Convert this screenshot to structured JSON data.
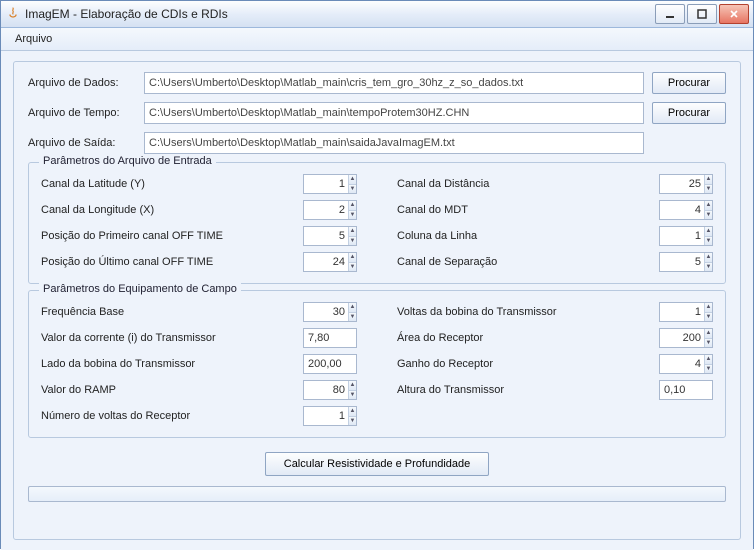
{
  "window": {
    "title": "ImagEM - Elaboração de CDIs e RDIs"
  },
  "menu": {
    "arquivo": "Arquivo"
  },
  "files": {
    "data_label": "Arquivo de Dados:",
    "data_value": "C:\\Users\\Umberto\\Desktop\\Matlab_main\\cris_tem_gro_30hz_z_so_dados.txt",
    "time_label": "Arquivo de Tempo:",
    "time_value": "C:\\Users\\Umberto\\Desktop\\Matlab_main\\tempoProtem30HZ.CHN",
    "out_label": "Arquivo de Saída:",
    "out_value": "C:\\Users\\Umberto\\Desktop\\Matlab_main\\saidaJavaImagEM.txt",
    "browse": "Procurar"
  },
  "group1": {
    "title": "Parâmetros do Arquivo de Entrada",
    "lat_label": "Canal da Latitude (Y)",
    "lat": "1",
    "lon_label": "Canal da Longitude (X)",
    "lon": "2",
    "first_off_label": "Posição do Primeiro canal OFF TIME",
    "first_off": "5",
    "last_off_label": "Posição do Último canal OFF TIME",
    "last_off": "24",
    "dist_label": "Canal da Distância",
    "dist": "25",
    "mdt_label": "Canal do MDT",
    "mdt": "4",
    "linha_label": "Coluna da Linha",
    "linha": "1",
    "sep_label": "Canal de Separação",
    "sep": "5"
  },
  "group2": {
    "title": "Parâmetros do Equipamento de Campo",
    "freq_label": "Frequência Base",
    "freq": "30",
    "corrente_label": "Valor da corrente (i) do Transmissor",
    "corrente": "7,80",
    "lado_label": "Lado da bobina do Transmissor",
    "lado": "200,00",
    "ramp_label": "Valor do RAMP",
    "ramp": "80",
    "voltas_rx_label": "Número de voltas do Receptor",
    "voltas_rx": "1",
    "voltas_tx_label": "Voltas da bobina do Transmissor",
    "voltas_tx": "1",
    "area_rx_label": "Área do Receptor",
    "area_rx": "200",
    "ganho_label": "Ganho do Receptor",
    "ganho": "4",
    "altura_label": "Altura do Transmissor",
    "altura": "0,10"
  },
  "calc_button": "Calcular Resistividade e Profundidade"
}
